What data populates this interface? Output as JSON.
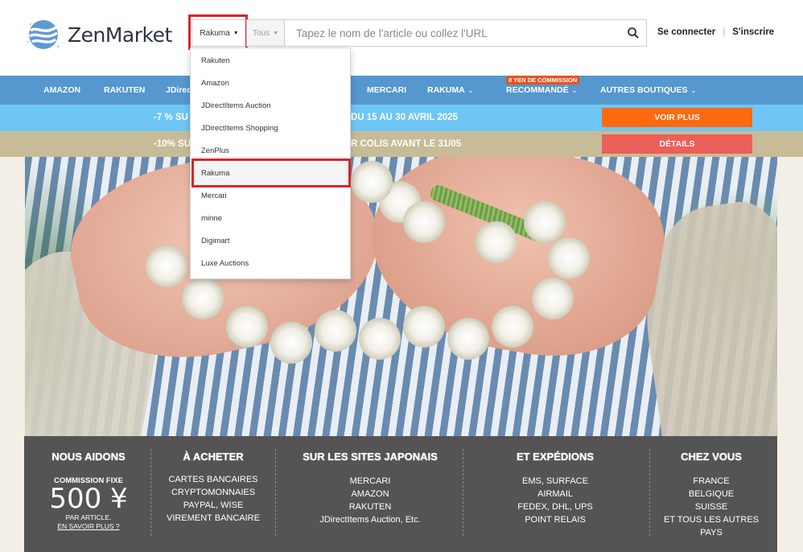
{
  "header": {
    "logo_text": "ZenMarket",
    "site_select": "Rakuma",
    "category_select": "Tous",
    "search_placeholder": "Tapez le nom de l'article ou collez l'URL",
    "login": "Se connecter",
    "separator": "|",
    "signup": "S'inscrire"
  },
  "site_dropdown": {
    "items": [
      "Rakuten",
      "Amazon",
      "JDirectItems Auction",
      "JDirectItems Shopping",
      "ZenPlus",
      "Rakuma",
      "Mercari",
      "minne",
      "Digimart",
      "Luxe Auctions"
    ],
    "selected": "Rakuma"
  },
  "nav": {
    "items": [
      "AMAZON",
      "RAKUTEN",
      "JDirect",
      "MERCARI",
      "RAKUMA",
      "RECOMMANDÉ",
      "AUTRES BOUTIQUES"
    ],
    "badge": "0 YEN DE COMMISSION"
  },
  "promos": {
    "promo1_left": "-7 % SU",
    "promo1_right": "DU 15 AU 30 AVRIL 2025",
    "promo1_button": "VOIR PLUS",
    "promo2_left": "-10% SU",
    "promo2_right": "R COLIS AVANT LE 31/05",
    "promo2_button": "DÉTAILS"
  },
  "info": {
    "col1": {
      "title": "NOUS AIDONS",
      "fee_label": "COMMISSION FIXE",
      "fee_price": "500 ¥",
      "fee_unit": "PAR ARTICLE.",
      "fee_link": "EN SAVOIR PLUS ?"
    },
    "col2": {
      "title": "À ACHETER",
      "lines": [
        "CARTES BANCAIRES",
        "CRYPTOMONNAIES",
        "PAYPAL, WISE",
        "VIREMENT BANCAIRE"
      ]
    },
    "col3": {
      "title": "SUR LES SITES JAPONAIS",
      "lines": [
        "MERCARI",
        "AMAZON",
        "RAKUTEN",
        "JDirectItems Auction, Etc."
      ]
    },
    "col4": {
      "title": "ET EXPÉDIONS",
      "lines": [
        "EMS, SURFACE",
        "AIRMAIL",
        "FEDEX, DHL, UPS",
        "POINT RELAIS"
      ]
    },
    "col5": {
      "title": "CHEZ VOUS",
      "lines": [
        "FRANCE",
        "BELGIQUE",
        "SUISSE",
        "ET TOUS LES AUTRES",
        "PAYS"
      ]
    }
  },
  "colors": {
    "nav": "#5597cf",
    "promo1": "#6ec6f4",
    "promo2": "#c8bb98",
    "voir_plus": "#ff6a10",
    "details": "#ec5f57",
    "highlight": "#d7262c"
  },
  "icons": {
    "search": "search-icon",
    "logo": "zenmarket-logo-icon"
  }
}
